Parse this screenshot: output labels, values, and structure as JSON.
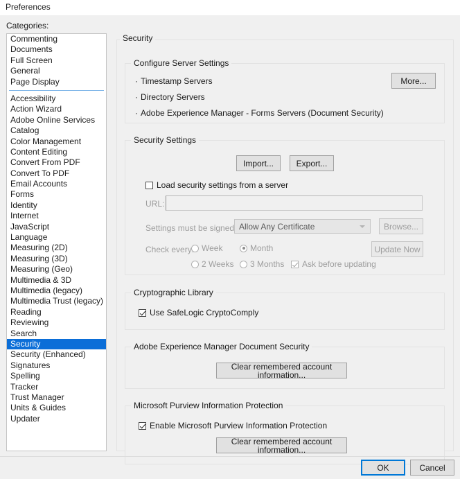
{
  "window": {
    "title": "Preferences"
  },
  "sidebar": {
    "label": "Categories:",
    "group1": [
      {
        "label": "Commenting"
      },
      {
        "label": "Documents"
      },
      {
        "label": "Full Screen"
      },
      {
        "label": "General"
      },
      {
        "label": "Page Display"
      }
    ],
    "group2": [
      {
        "label": "Accessibility"
      },
      {
        "label": "Action Wizard"
      },
      {
        "label": "Adobe Online Services"
      },
      {
        "label": "Catalog"
      },
      {
        "label": "Color Management"
      },
      {
        "label": "Content Editing"
      },
      {
        "label": "Convert From PDF"
      },
      {
        "label": "Convert To PDF"
      },
      {
        "label": "Email Accounts"
      },
      {
        "label": "Forms"
      },
      {
        "label": "Identity"
      },
      {
        "label": "Internet"
      },
      {
        "label": "JavaScript"
      },
      {
        "label": "Language"
      },
      {
        "label": "Measuring (2D)"
      },
      {
        "label": "Measuring (3D)"
      },
      {
        "label": "Measuring (Geo)"
      },
      {
        "label": "Multimedia & 3D"
      },
      {
        "label": "Multimedia (legacy)"
      },
      {
        "label": "Multimedia Trust (legacy)"
      },
      {
        "label": "Reading"
      },
      {
        "label": "Reviewing"
      },
      {
        "label": "Search"
      },
      {
        "label": "Security"
      },
      {
        "label": "Security (Enhanced)"
      },
      {
        "label": "Signatures"
      },
      {
        "label": "Spelling"
      },
      {
        "label": "Tracker"
      },
      {
        "label": "Trust Manager"
      },
      {
        "label": "Units & Guides"
      },
      {
        "label": "Updater"
      }
    ],
    "selected": "Security",
    "selection_color": "#0b6ed8",
    "separator_color": "#7cb4e8"
  },
  "panel": {
    "heading": "Security",
    "server_settings": {
      "title": "Configure Server Settings",
      "items": [
        "Timestamp Servers",
        "Directory Servers",
        "Adobe Experience Manager - Forms Servers (Document Security)"
      ],
      "more_button": "More..."
    },
    "security_settings": {
      "title": "Security Settings",
      "import_button": "Import...",
      "export_button": "Export...",
      "load_from_server_label": "Load security settings from a server",
      "load_from_server_checked": false,
      "url_label": "URL:",
      "url_value": "",
      "signed_by_label": "Settings must be signed by:",
      "signed_by_value": "Allow Any Certificate",
      "browse_button": "Browse...",
      "check_every_label": "Check every:",
      "radios": [
        {
          "label": "Week",
          "selected": false
        },
        {
          "label": "Month",
          "selected": true
        },
        {
          "label": "2 Weeks",
          "selected": false
        },
        {
          "label": "3 Months",
          "selected": false
        }
      ],
      "ask_before_updating_label": "Ask before updating",
      "ask_before_updating_checked": true,
      "update_now_button": "Update Now"
    },
    "crypto_library": {
      "title": "Cryptographic Library",
      "safelogic_label": "Use SafeLogic CryptoComply",
      "safelogic_checked": true
    },
    "aem_document_security": {
      "title": "Adobe Experience Manager Document Security",
      "clear_button": "Clear remembered account information..."
    },
    "purview": {
      "title": "Microsoft Purview Information Protection",
      "enable_label": "Enable Microsoft Purview Information Protection",
      "enable_checked": true,
      "clear_button": "Clear remembered account information..."
    }
  },
  "footer": {
    "ok_button": "OK",
    "cancel_button": "Cancel",
    "focus_color": "#0078d7"
  }
}
